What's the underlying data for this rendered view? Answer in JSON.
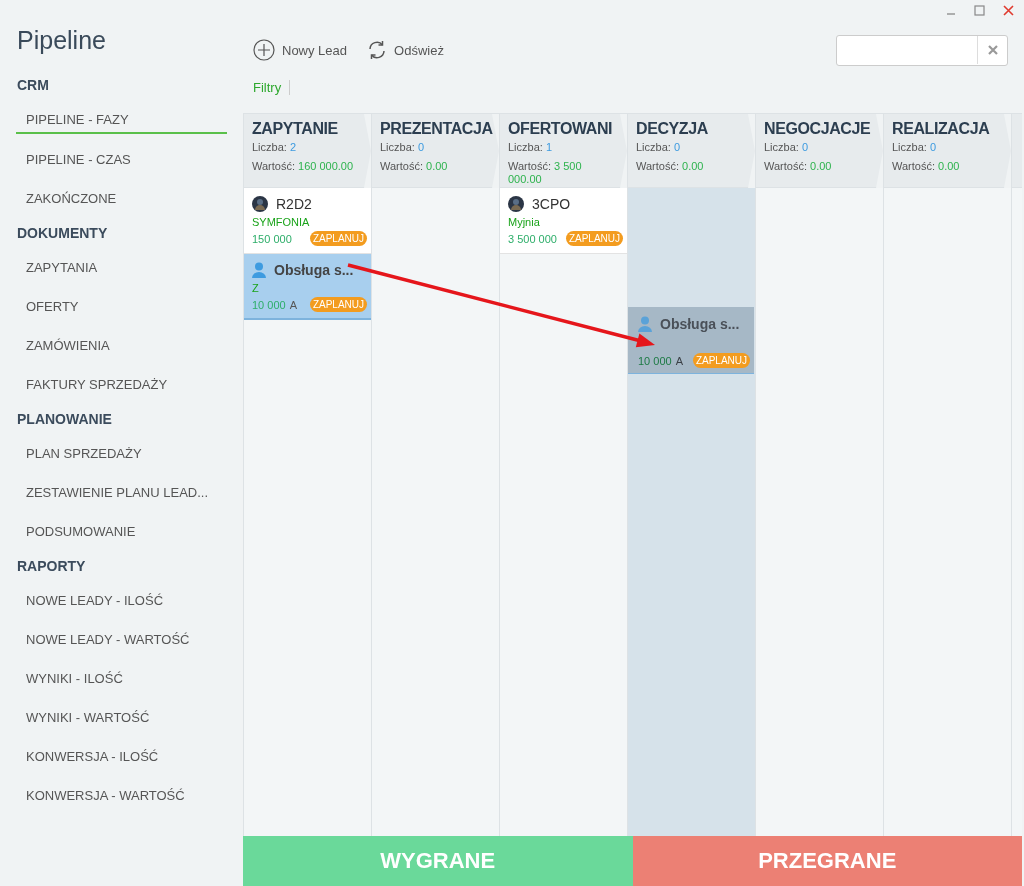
{
  "app_title": "Pipeline",
  "sidebar": [
    {
      "heading": "CRM",
      "items": [
        {
          "label": "PIPELINE - FAZY",
          "selected": true
        },
        {
          "label": "PIPELINE - CZAS",
          "selected": false
        },
        {
          "label": "ZAKOŃCZONE",
          "selected": false
        }
      ]
    },
    {
      "heading": "DOKUMENTY",
      "items": [
        {
          "label": "ZAPYTANIA",
          "selected": false
        },
        {
          "label": "OFERTY",
          "selected": false
        },
        {
          "label": "ZAMÓWIENIA",
          "selected": false
        },
        {
          "label": "FAKTURY SPRZEDAŻY",
          "selected": false
        }
      ]
    },
    {
      "heading": "PLANOWANIE",
      "items": [
        {
          "label": "PLAN SPRZEDAŻY",
          "selected": false
        },
        {
          "label": "ZESTAWIENIE PLANU LEAD...",
          "selected": false
        },
        {
          "label": "PODSUMOWANIE",
          "selected": false
        }
      ]
    },
    {
      "heading": "RAPORTY",
      "items": [
        {
          "label": "NOWE LEADY - ILOŚĆ",
          "selected": false
        },
        {
          "label": "NOWE LEADY - WARTOŚĆ",
          "selected": false
        },
        {
          "label": "WYNIKI - ILOŚĆ",
          "selected": false
        },
        {
          "label": "WYNIKI - WARTOŚĆ",
          "selected": false
        },
        {
          "label": "KONWERSJA - ILOŚĆ",
          "selected": false
        },
        {
          "label": "KONWERSJA - WARTOŚĆ",
          "selected": false
        }
      ]
    }
  ],
  "toolbar": {
    "new_lead": "Nowy Lead",
    "refresh": "Odśwież",
    "filters": "Filtry"
  },
  "columns": [
    {
      "title": "ZAPYTANIE",
      "count_label": "Liczba:",
      "count": "2",
      "value_label": "Wartość:",
      "value": "160 000.00",
      "highlighted": false,
      "cards": [
        {
          "name": "R2D2",
          "kind": "photo",
          "company": "SYMFONIA",
          "amount": "150 000",
          "badge": "ZAPLANUJ",
          "selected": false
        },
        {
          "name": "Obsługa s...",
          "kind": "person",
          "company": "Z",
          "amount": "10 000",
          "owner": "A",
          "badge": "ZAPLANUJ",
          "selected": true
        }
      ]
    },
    {
      "title": "PREZENTACJA",
      "count_label": "Liczba:",
      "count": "0",
      "value_label": "Wartość:",
      "value": "0.00",
      "highlighted": false
    },
    {
      "title": "OFERTOWANI",
      "count_label": "Liczba:",
      "count": "1",
      "value_label": "Wartość:",
      "value": "3 500 000.00",
      "highlighted": false,
      "cards": [
        {
          "name": "3CPO",
          "kind": "photo",
          "company": "Myjnia",
          "amount": "3 500 000",
          "badge": "ZAPLANUJ",
          "selected": false
        }
      ]
    },
    {
      "title": "DECYZJA",
      "count_label": "Liczba:",
      "count": "0",
      "value_label": "Wartość:",
      "value": "0.00",
      "highlighted": true
    },
    {
      "title": "NEGOCJACJE",
      "count_label": "Liczba:",
      "count": "0",
      "value_label": "Wartość:",
      "value": "0.00",
      "highlighted": false
    },
    {
      "title": "REALIZACJA",
      "count_label": "Liczba:",
      "count": "0",
      "value_label": "Wartość:",
      "value": "0.00",
      "highlighted": false
    }
  ],
  "drag_card": {
    "name": "Obsługa s...",
    "kind": "person",
    "amount": "10 000",
    "owner": "A",
    "badge": "ZAPLANUJ"
  },
  "drop_zones": [
    {
      "label": "WYGRANE",
      "kind": "won"
    },
    {
      "label": "PRZEGRANE",
      "kind": "lost"
    }
  ]
}
